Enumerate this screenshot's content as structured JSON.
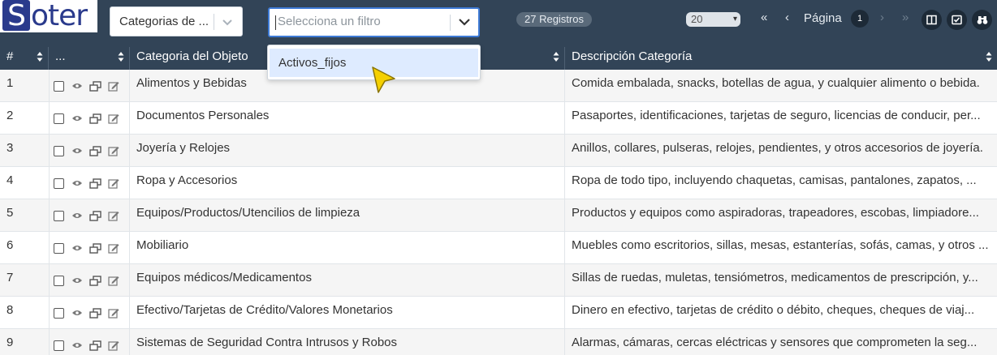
{
  "app": {
    "logo_text": "Soter",
    "logo_initial": "S",
    "logo_rest": "oter"
  },
  "toolbar": {
    "category_select": "Categorias de ...",
    "filter_placeholder": "Selecciona un filtro",
    "records_badge": "27 Registros",
    "page_size": "20",
    "page_label": "Página",
    "page_number": "1",
    "first_page_icon": "«",
    "prev_page_icon": "‹",
    "next_page_icon": "›",
    "last_page_icon": "»"
  },
  "filter_menu": {
    "options": [
      "Activos_fijos"
    ]
  },
  "table": {
    "headers": {
      "index": "#",
      "actions": "...",
      "category": "Categoria del Objeto",
      "description": "Descripción Categoría"
    },
    "rows": [
      {
        "n": "1",
        "category": "Alimentos y Bebidas",
        "description": "Comida embalada, snacks, botellas de agua, y cualquier alimento o bebida."
      },
      {
        "n": "2",
        "category": "Documentos Personales",
        "description": "Pasaportes, identificaciones, tarjetas de seguro, licencias de conducir, per..."
      },
      {
        "n": "3",
        "category": "Joyería y Relojes",
        "description": "Anillos, collares, pulseras, relojes, pendientes, y otros accesorios de joyería."
      },
      {
        "n": "4",
        "category": "Ropa y Accesorios",
        "description": "Ropa de todo tipo, incluyendo chaquetas, camisas, pantalones, zapatos, ..."
      },
      {
        "n": "5",
        "category": "Equipos/Productos/Utencilios de limpieza",
        "description": "Productos y equipos como aspiradoras, trapeadores, escobas, limpiadore..."
      },
      {
        "n": "6",
        "category": "Mobiliario",
        "description": "Muebles como escritorios, sillas, mesas, estanterías, sofás, camas, y otros ..."
      },
      {
        "n": "7",
        "category": "Equipos médicos/Medicamentos",
        "description": "Sillas de ruedas, muletas, tensiómetros, medicamentos de prescripción, y..."
      },
      {
        "n": "8",
        "category": "Efectivo/Tarjetas de Crédito/Valores Monetarios",
        "description": "Dinero en efectivo, tarjetas de crédito o débito, cheques, cheques de viaj..."
      },
      {
        "n": "9",
        "category": "Sistemas de Seguridad Contra Intrusos y Robos",
        "description": "Alarmas, cámaras, cercas eléctricas y sensores que comprometen la seg..."
      }
    ]
  },
  "colors": {
    "header_bg": "#324457",
    "accent": "#3e7bd6",
    "row_alt": "#f5f5f5",
    "option_highlight": "#deebff",
    "cursor": "#f5d000"
  }
}
